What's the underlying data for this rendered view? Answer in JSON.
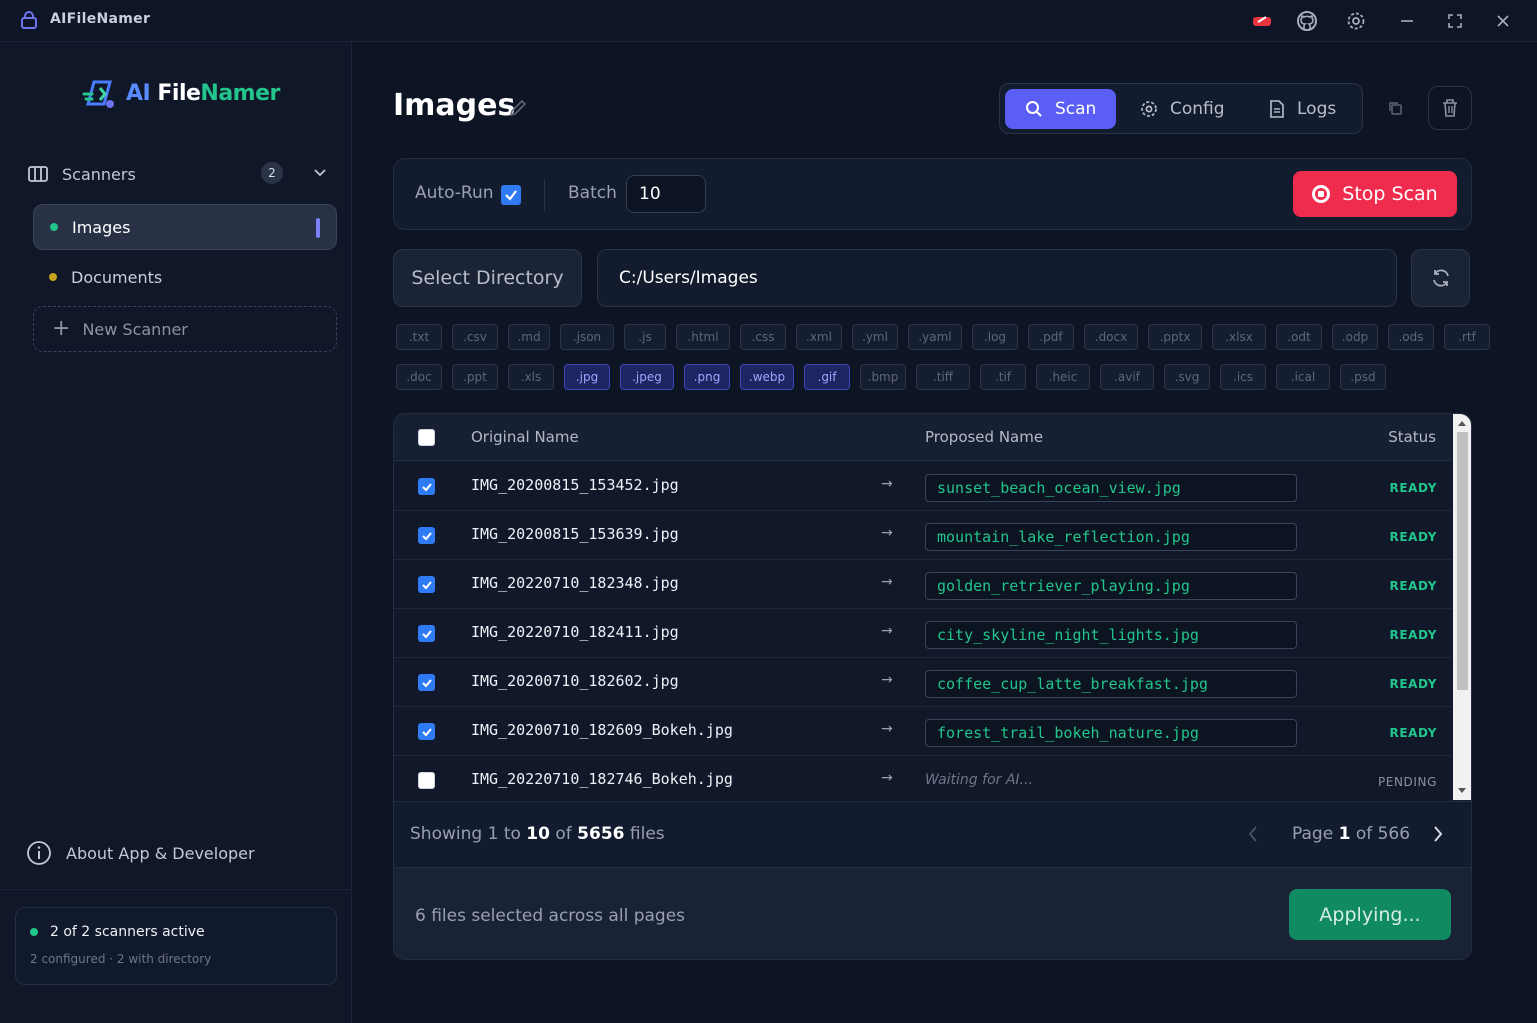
{
  "window": {
    "title": "AIFileNamer",
    "buttons": [
      "accent-icon",
      "github-icon",
      "gear-icon",
      "minimize-icon",
      "maximize-icon",
      "close-icon"
    ]
  },
  "sidebar": {
    "logo": {
      "ai": "AI",
      "file": "File",
      "namer": "Namer"
    },
    "scanners_label": "Scanners",
    "scanners_count": "2",
    "items": [
      {
        "label": "Images",
        "dot_color": "#22c58b",
        "active": true
      },
      {
        "label": "Documents",
        "dot_color": "#c7a21e",
        "active": false
      }
    ],
    "new_scanner": "New Scanner",
    "about": "About App & Developer",
    "status": {
      "active": "2 of 2 scanners active",
      "detail": "2 configured · 2 with directory"
    }
  },
  "header": {
    "title": "Images",
    "tabs": [
      {
        "label": "Scan",
        "icon": "search-icon",
        "active": true
      },
      {
        "label": "Config",
        "icon": "gear-icon",
        "active": false
      },
      {
        "label": "Logs",
        "icon": "document-icon",
        "active": false
      }
    ]
  },
  "controls": {
    "autorun_label": "Auto-Run",
    "autorun_checked": true,
    "batch_label": "Batch",
    "batch_value": "10",
    "stop_label": "Stop Scan"
  },
  "directory": {
    "select_label": "Select Directory",
    "path": "C:/Users/Images"
  },
  "extensions": {
    "row1": [
      {
        "ext": ".txt",
        "on": false
      },
      {
        "ext": ".csv",
        "on": false
      },
      {
        "ext": ".md",
        "on": false
      },
      {
        "ext": ".json",
        "on": false
      },
      {
        "ext": ".js",
        "on": false
      },
      {
        "ext": ".html",
        "on": false
      },
      {
        "ext": ".css",
        "on": false
      },
      {
        "ext": ".xml",
        "on": false
      },
      {
        "ext": ".yml",
        "on": false
      },
      {
        "ext": ".yaml",
        "on": false
      },
      {
        "ext": ".log",
        "on": false
      },
      {
        "ext": ".pdf",
        "on": false
      },
      {
        "ext": ".docx",
        "on": false
      },
      {
        "ext": ".pptx",
        "on": false
      },
      {
        "ext": ".xlsx",
        "on": false
      },
      {
        "ext": ".odt",
        "on": false
      },
      {
        "ext": ".odp",
        "on": false
      },
      {
        "ext": ".ods",
        "on": false
      },
      {
        "ext": ".rtf",
        "on": false
      }
    ],
    "row2": [
      {
        "ext": ".doc",
        "on": false
      },
      {
        "ext": ".ppt",
        "on": false
      },
      {
        "ext": ".xls",
        "on": false
      },
      {
        "ext": ".jpg",
        "on": true
      },
      {
        "ext": ".jpeg",
        "on": true
      },
      {
        "ext": ".png",
        "on": true
      },
      {
        "ext": ".webp",
        "on": true
      },
      {
        "ext": ".gif",
        "on": true
      },
      {
        "ext": ".bmp",
        "on": false
      },
      {
        "ext": ".tiff",
        "on": false
      },
      {
        "ext": ".tif",
        "on": false
      },
      {
        "ext": ".heic",
        "on": false
      },
      {
        "ext": ".avif",
        "on": false
      },
      {
        "ext": ".svg",
        "on": false
      },
      {
        "ext": ".ics",
        "on": false
      },
      {
        "ext": ".ical",
        "on": false
      },
      {
        "ext": ".psd",
        "on": false
      }
    ]
  },
  "table": {
    "headers": {
      "original": "Original Name",
      "proposed": "Proposed Name",
      "status": "Status"
    },
    "rows": [
      {
        "checked": true,
        "original": "IMG_20200815_153452.jpg",
        "proposed": "sunset_beach_ocean_view.jpg",
        "status": "READY"
      },
      {
        "checked": true,
        "original": "IMG_20200815_153639.jpg",
        "proposed": "mountain_lake_reflection.jpg",
        "status": "READY"
      },
      {
        "checked": true,
        "original": "IMG_20220710_182348.jpg",
        "proposed": "golden_retriever_playing.jpg",
        "status": "READY"
      },
      {
        "checked": true,
        "original": "IMG_20220710_182411.jpg",
        "proposed": "city_skyline_night_lights.jpg",
        "status": "READY"
      },
      {
        "checked": true,
        "original": "IMG_20200710_182602.jpg",
        "proposed": "coffee_cup_latte_breakfast.jpg",
        "status": "READY"
      },
      {
        "checked": true,
        "original": "IMG_20200710_182609_Bokeh.jpg",
        "proposed": "forest_trail_bokeh_nature.jpg",
        "status": "READY"
      },
      {
        "checked": false,
        "original": "IMG_20220710_182746_Bokeh.jpg",
        "proposed": "",
        "waiting": "Waiting for AI...",
        "status": "PENDING"
      }
    ],
    "footer": {
      "showing_prefix": "Showing",
      "from": "1",
      "to_word": "to",
      "to": "10",
      "of_word": "of",
      "total": "5656",
      "files_word": "files",
      "page_word": "Page",
      "page": "1",
      "page_of": "of 566"
    }
  },
  "apply": {
    "selected_text": "6 files selected across all pages",
    "button": "Applying..."
  },
  "colors": {
    "accent": "#5b5ef5",
    "ready": "#22c58b",
    "danger": "#f02c4e",
    "apply": "#108a60"
  }
}
